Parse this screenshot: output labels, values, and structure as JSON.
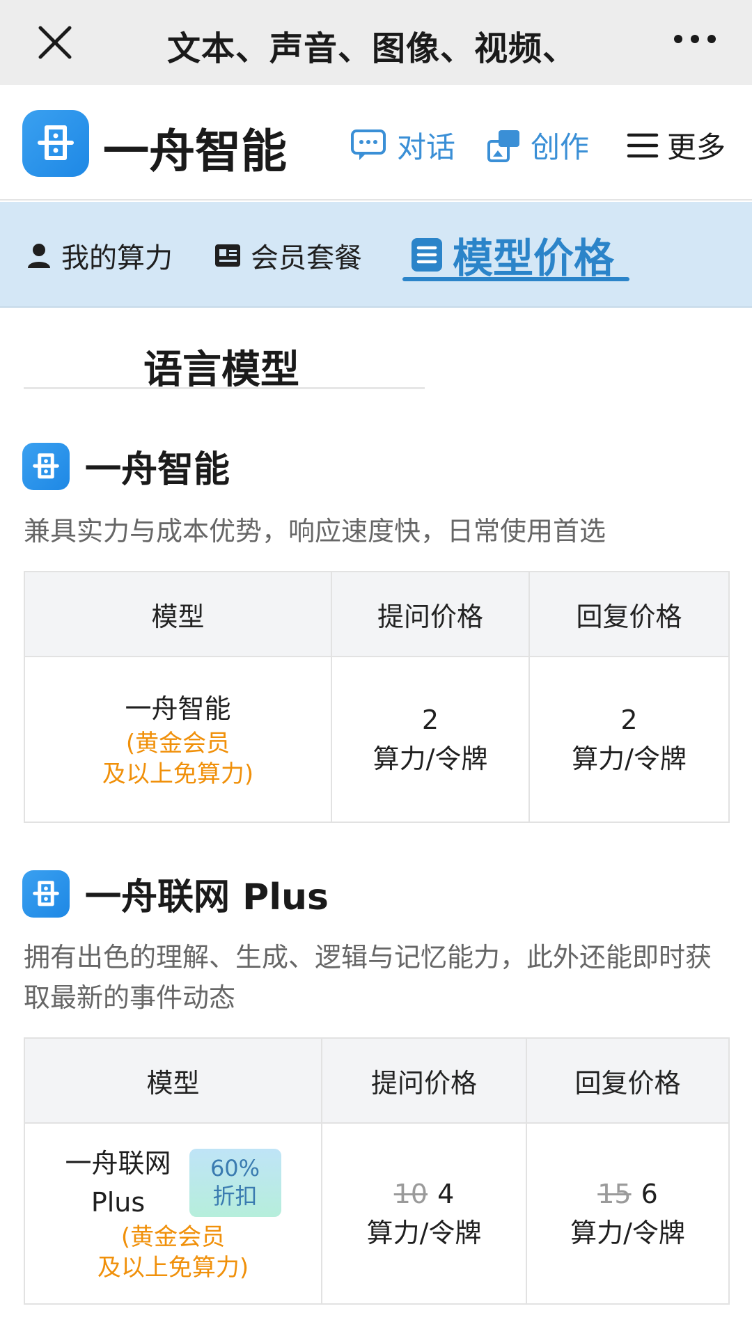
{
  "topbar": {
    "title": "文本、声音、图像、视频、",
    "close_icon": "close-icon",
    "more_icon": "more-dots-icon"
  },
  "header": {
    "brand": "一舟智能",
    "nav": [
      {
        "label": "对话",
        "icon": "chat-icon"
      },
      {
        "label": "创作",
        "icon": "create-icon"
      },
      {
        "label": "更多",
        "icon": "menu-icon"
      }
    ]
  },
  "subtabs": [
    {
      "label": "我的算力",
      "icon": "user-icon"
    },
    {
      "label": "会员套餐",
      "icon": "card-icon"
    },
    {
      "label": "模型价格",
      "icon": "list-icon",
      "active": true
    }
  ],
  "section": {
    "title": "语言模型"
  },
  "models": [
    {
      "name": "一舟智能",
      "desc": "兼具实力与成本优势，响应速度快，日常使用首选",
      "headers": [
        "模型",
        "提问价格",
        "回复价格"
      ],
      "row": {
        "model": "一舟智能",
        "note_line1": "(黄金会员",
        "note_line2": "及以上免算力)",
        "ask_value": "2",
        "ask_unit": "算力/令牌",
        "reply_value": "2",
        "reply_unit": "算力/令牌"
      }
    },
    {
      "name": "一舟联网 Plus",
      "desc": "拥有出色的理解、生成、逻辑与记忆能力，此外还能即时获取最新的事件动态",
      "headers": [
        "模型",
        "提问价格",
        "回复价格"
      ],
      "row": {
        "model_line1": "一舟联网",
        "model_line2": "Plus",
        "badge_line1": "60%",
        "badge_line2": "折扣",
        "note_line1": "(黄金会员",
        "note_line2": "及以上免算力)",
        "ask_old": "10",
        "ask_value": "4",
        "ask_unit": "算力/令牌",
        "reply_old": "15",
        "reply_value": "6",
        "reply_unit": "算力/令牌"
      }
    }
  ],
  "colors": {
    "accent": "#2b84c9",
    "tab_bg": "#d4e7f6",
    "note_orange": "#f0900a"
  }
}
